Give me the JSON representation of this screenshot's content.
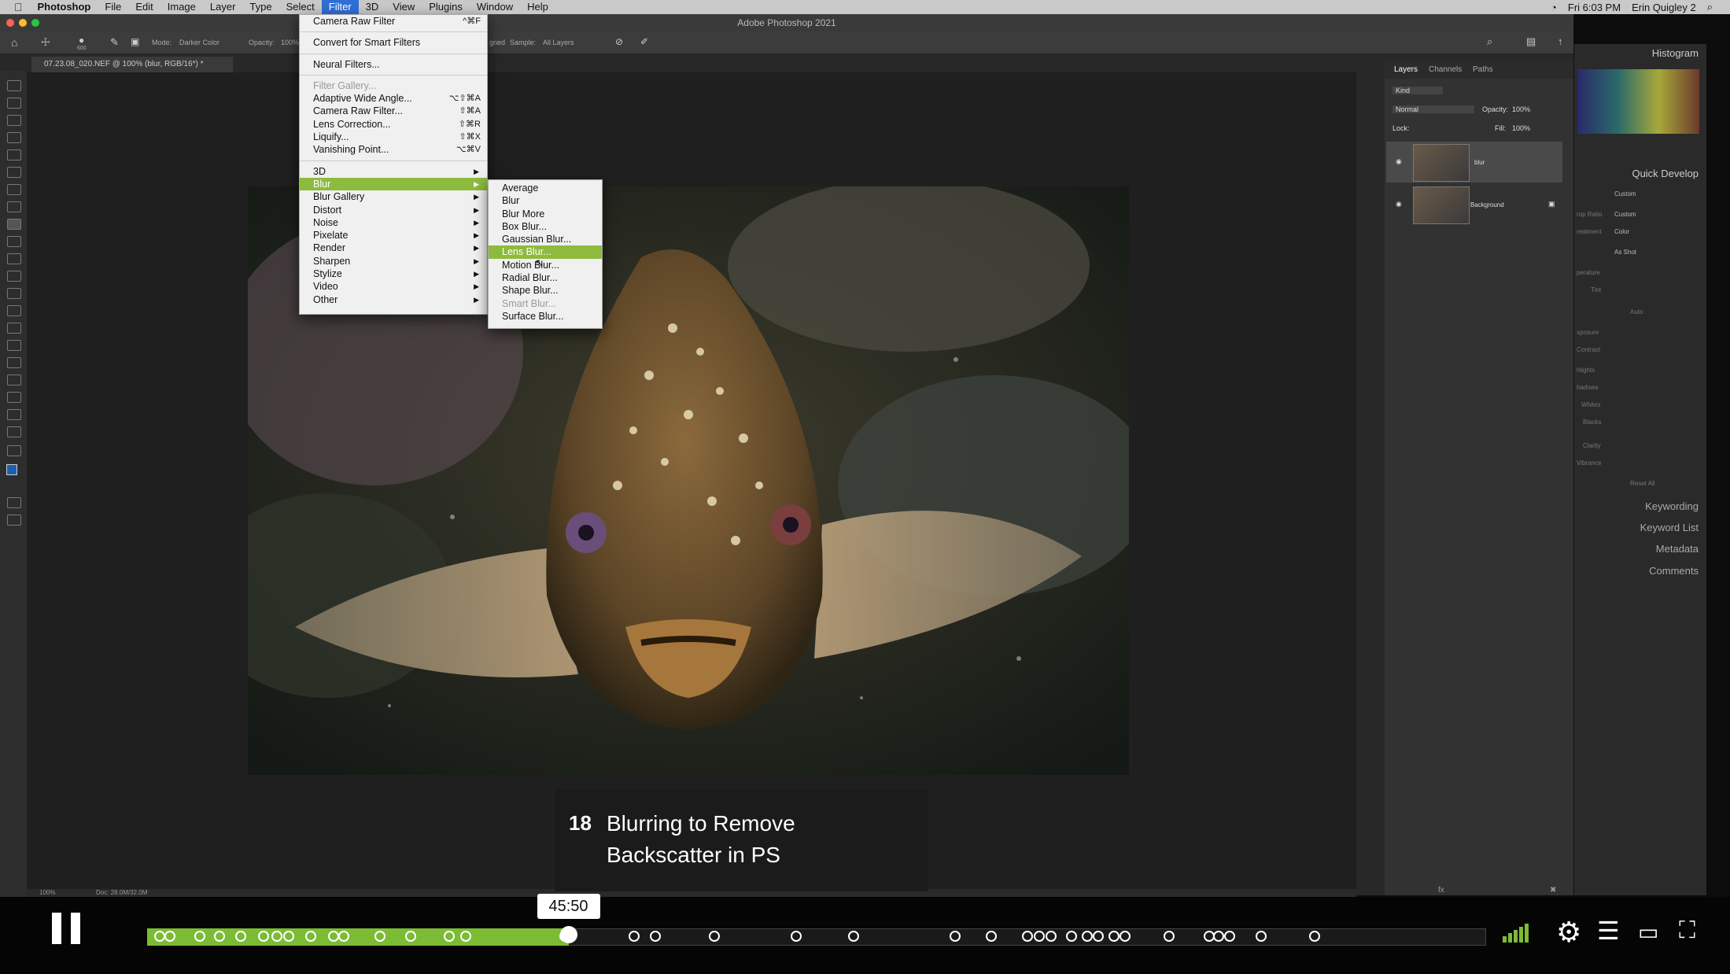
{
  "menubar": {
    "app": "Photoshop",
    "items": [
      "File",
      "Edit",
      "Image",
      "Layer",
      "Type",
      "Select",
      "Filter",
      "3D",
      "View",
      "Plugins",
      "Window",
      "Help"
    ],
    "active": "Filter",
    "clock": "Fri 6:03 PM",
    "user": "Erin Quigley 2"
  },
  "window": {
    "title": "Adobe Photoshop 2021"
  },
  "options_bar": {
    "mode_label": "Mode:",
    "mode_value": "Darker Color",
    "opacity_label": "Opacity:",
    "opacity_value": "100%",
    "aligned_label": "gned",
    "sample_label": "Sample:",
    "sample_value": "All Layers",
    "brush_size": "600"
  },
  "document_tab": {
    "name": "07.23.08_020.NEF @ 100% (blur, RGB/16*) *"
  },
  "status_bar": {
    "zoom": "100%",
    "doc": "Doc: 28.0M/32.0M"
  },
  "filter_menu": {
    "top": [
      {
        "label": "Camera Raw Filter",
        "shortcut": "^⌘F"
      }
    ],
    "convert": "Convert for Smart Filters",
    "neural": "Neural Filters...",
    "gallery": "Filter Gallery...",
    "shortcuts_items": [
      {
        "label": "Adaptive Wide Angle...",
        "shortcut": "⌥⇧⌘A"
      },
      {
        "label": "Camera Raw Filter...",
        "shortcut": "⇧⌘A"
      },
      {
        "label": "Lens Correction...",
        "shortcut": "⇧⌘R"
      },
      {
        "label": "Liquify...",
        "shortcut": "⇧⌘X"
      },
      {
        "label": "Vanishing Point...",
        "shortcut": "⌥⌘V"
      }
    ],
    "groups": [
      "3D",
      "Blur",
      "Blur Gallery",
      "Distort",
      "Noise",
      "Pixelate",
      "Render",
      "Sharpen",
      "Stylize",
      "Video",
      "Other"
    ],
    "highlighted": "Blur"
  },
  "blur_submenu": {
    "items": [
      "Average",
      "Blur",
      "Blur More",
      "Box Blur...",
      "Gaussian Blur...",
      "Lens Blur...",
      "Motion Blur...",
      "Radial Blur...",
      "Shape Blur...",
      "Smart Blur...",
      "Surface Blur..."
    ],
    "highlighted": "Lens Blur...",
    "disabled": "Smart Blur..."
  },
  "layers_panel": {
    "tabs": [
      "Layers",
      "Channels",
      "Paths"
    ],
    "filter_kind": "Kind",
    "blend_mode": "Normal",
    "opacity_label": "Opacity:",
    "opacity_value": "100%",
    "lock_label": "Lock:",
    "fill_label": "Fill:",
    "fill_value": "100%",
    "layers": [
      {
        "name": "blur"
      },
      {
        "name": "Background"
      }
    ]
  },
  "lightroom_panel": {
    "histogram": "Histogram",
    "quick_develop": "Quick Develop",
    "preset": "Custom",
    "crop_label": "rop Ratio",
    "crop_value": "Custom",
    "treatment_label": "reatment",
    "treatment_value": "Color",
    "wb_value": "As Shot",
    "temp_label": "perature",
    "tint_label": "Tint",
    "auto_label": "Auto",
    "exposure_label": "xposure",
    "contrast_label": "Contrast",
    "highlights_label": "hlights",
    "shadows_label": "hadows",
    "whites_label": "Whites",
    "blacks_label": "Blacks",
    "clarity_label": "Clarity",
    "vibrance_label": "Vibrance",
    "reset": "Reset All",
    "keywording": "Keywording",
    "keyword_list": "Keyword List",
    "metadata": "Metadata",
    "comments": "Comments"
  },
  "caption": {
    "number": "18",
    "line1": "Blurring to Remove",
    "line2": "Backscatter in PS"
  },
  "player": {
    "time": "45:50",
    "progress": 0.315,
    "accent": "#7cbb34",
    "chapter_markers": [
      0.005,
      0.013,
      0.035,
      0.05,
      0.066,
      0.083,
      0.093,
      0.102,
      0.118,
      0.135,
      0.143,
      0.17,
      0.193,
      0.222,
      0.234,
      0.308,
      0.36,
      0.376,
      0.42,
      0.481,
      0.524,
      0.6,
      0.627,
      0.654,
      0.663,
      0.672,
      0.687,
      0.699,
      0.707,
      0.719,
      0.727,
      0.76,
      0.79,
      0.797,
      0.805,
      0.829,
      0.869
    ]
  },
  "colors": {
    "menu_highlight": "#8dbb3e",
    "mac_active": "#2f6fd6"
  }
}
